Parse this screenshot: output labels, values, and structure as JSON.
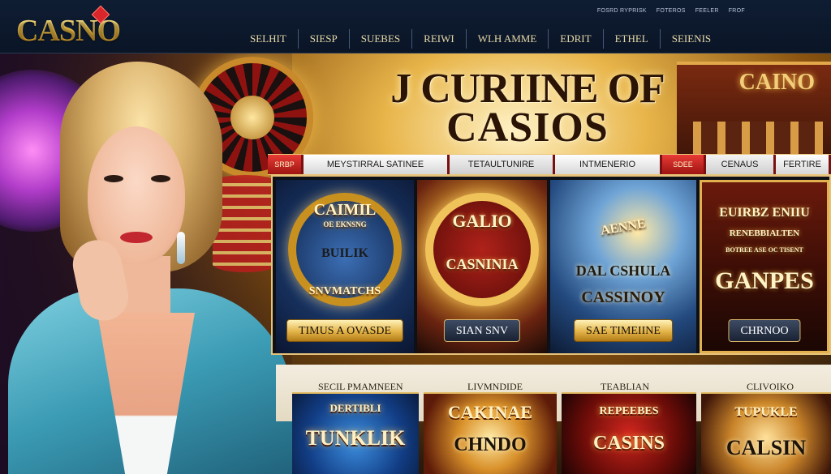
{
  "header": {
    "logo_text": "CASNO",
    "utility_links": [
      "FOSRD RYPRISK",
      "FOTEROS",
      "FEELER",
      "FROF"
    ],
    "nav": [
      "SELHIT",
      "SIESP",
      "SUEBES",
      "REIWI",
      "WLH AMME",
      "EDRIT",
      "ETHEL",
      "SEIENIS"
    ]
  },
  "hero": {
    "title_line1": "J CURIINE OF",
    "title_line2": "CASIOS",
    "building_sign": "CAINO"
  },
  "categories": [
    "SRBP",
    "MEYSTIRRAL SATINEE",
    "TETAULTUNIRE",
    "INTMENERIO",
    "SDEE",
    "CENAUS",
    "FERTIRE"
  ],
  "cards": [
    {
      "name": "CAIMIL",
      "sub": "OE EKNSNG",
      "mid": "BUILIK",
      "bottom": "SNVMATCHS",
      "button": "TIMUS A OVASDE"
    },
    {
      "name": "GALIO",
      "sub": "",
      "mid": "CASNINIA",
      "bottom": "",
      "button": "SIAN SNV"
    },
    {
      "name": "AENNE",
      "sub": "",
      "mid": "DAL CSHULA",
      "bottom": "CASSINOY",
      "button": "SAE TIMEIINE"
    },
    {
      "name": "EUIRBZ ENIIU",
      "sub": "RENEBBIALTEN",
      "mid": "BOTREE ASE OC TISENT",
      "bottom": "GANPES",
      "button": "CHRNOO"
    }
  ],
  "section_labels": [
    "SECIL PMAMNEEN",
    "LIVMNDIDE",
    "TEABLIAN",
    "CLIVOIKO"
  ],
  "tiles": [
    "TUNKLIK",
    "CHNDO",
    "CASINS",
    "CALSIN"
  ],
  "tile_tops": [
    "DERTIBLI",
    "CAKINAE",
    "REPEEBES",
    "TUPUKLE"
  ]
}
